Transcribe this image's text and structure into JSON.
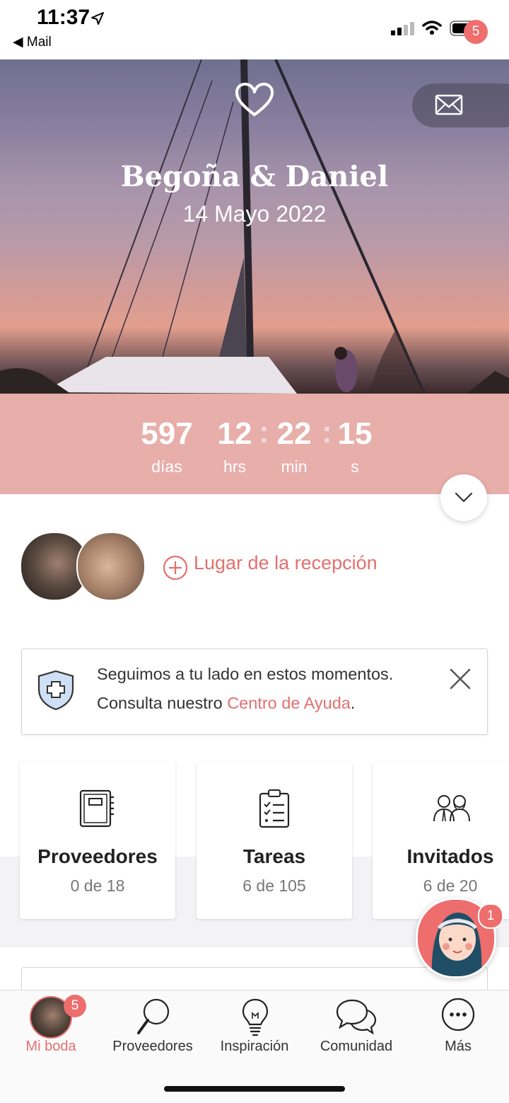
{
  "status_bar": {
    "time": "11:37",
    "back_label": "◀ Mail"
  },
  "header": {
    "couple": "Begoña & Daniel",
    "date": "14 Mayo 2022",
    "mail_badge": "5"
  },
  "countdown": {
    "days": "597",
    "days_label": "días",
    "hours": "12",
    "hours_label": "hrs",
    "minutes": "22",
    "minutes_label": "min",
    "seconds": "15",
    "seconds_label": "s",
    "separator": ":"
  },
  "reception": {
    "label": "Lugar de la recepción"
  },
  "help": {
    "line1": "Seguimos a tu lado en estos momentos.",
    "line2_prefix": "Consulta nuestro ",
    "link": "Centro de Ayuda",
    "line2_suffix": "."
  },
  "cards": [
    {
      "title": "Proveedores",
      "subtitle": "0 de 18",
      "icon": "notebook-icon"
    },
    {
      "title": "Tareas",
      "subtitle": "6 de 105",
      "icon": "checklist-icon"
    },
    {
      "title": "Invitados",
      "subtitle": "6 de 20",
      "icon": "guests-icon"
    }
  ],
  "assistant": {
    "badge": "1"
  },
  "tabbar": {
    "tabs": [
      {
        "label": "Mi boda",
        "badge": "5",
        "icon": "avatar-icon"
      },
      {
        "label": "Proveedores",
        "icon": "search-icon"
      },
      {
        "label": "Inspiración",
        "icon": "lightbulb-icon"
      },
      {
        "label": "Comunidad",
        "icon": "chat-bubbles-icon"
      },
      {
        "label": "Más",
        "icon": "more-icon"
      }
    ]
  },
  "colors": {
    "accent": "#e46f6f",
    "countdown_bg": "#e8aeaa",
    "badge": "#ee6d6d"
  }
}
